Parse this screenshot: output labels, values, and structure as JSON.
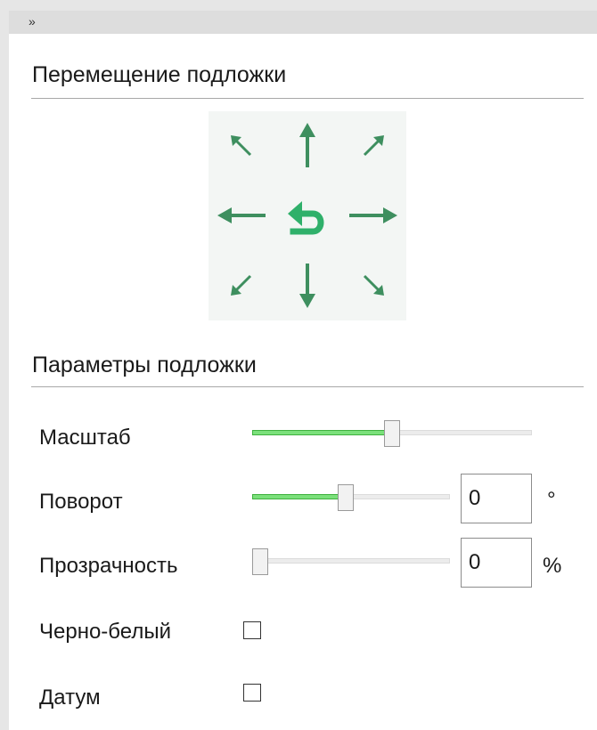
{
  "topbar": {
    "collapse_glyph": "»"
  },
  "move_section": {
    "title": "Перемещение подложки",
    "buttons": [
      {
        "name": "arrow-up-left-icon"
      },
      {
        "name": "arrow-up-icon"
      },
      {
        "name": "arrow-up-right-icon"
      },
      {
        "name": "arrow-left-icon"
      },
      {
        "name": "reset-icon"
      },
      {
        "name": "arrow-right-icon"
      },
      {
        "name": "arrow-down-left-icon"
      },
      {
        "name": "arrow-down-icon"
      },
      {
        "name": "arrow-down-right-icon"
      }
    ],
    "arrow_color": "#3e8f5f",
    "reset_color": "#2fb06a"
  },
  "params_section": {
    "title": "Параметры подложки",
    "scale": {
      "label": "Масштаб",
      "level": 0.5
    },
    "rotation": {
      "label": "Поворот",
      "level": 0.47,
      "value": "0",
      "unit": "°"
    },
    "opacity": {
      "label": "Прозрачность",
      "level": 0.0,
      "value": "0",
      "unit": "%"
    },
    "bw": {
      "label": "Черно-белый",
      "checked": false
    },
    "datum": {
      "label": "Датум",
      "checked": false
    }
  }
}
